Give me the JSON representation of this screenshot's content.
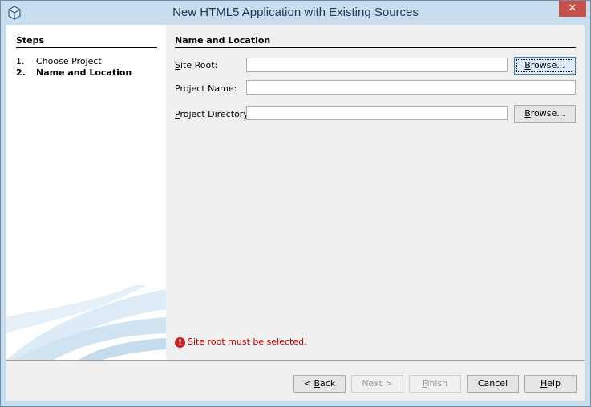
{
  "window": {
    "title": "New HTML5 Application with Existing Sources",
    "close_glyph": "✕"
  },
  "steps": {
    "header": "Steps",
    "items": [
      {
        "num": "1.",
        "label": "Choose Project"
      },
      {
        "num": "2.",
        "label": "Name and Location"
      }
    ]
  },
  "form": {
    "section_title": "Name and Location",
    "site_root": {
      "label_mnemonic": "S",
      "label_rest": "ite Root:",
      "value": "",
      "browse_mnemonic": "B",
      "browse_rest": "rowse..."
    },
    "project_name": {
      "label": "Project Name:",
      "value": ""
    },
    "project_directory": {
      "label_mnemonic": "P",
      "label_rest": "roject Directory:",
      "value": "",
      "browse_mnemonic": "B",
      "browse_rest": "rowse..."
    },
    "error_glyph": "!",
    "error_message": "Site root must be selected."
  },
  "buttons": {
    "back_prefix": "< ",
    "back_mnemonic": "B",
    "back_rest": "ack",
    "next": "Next >",
    "finish_mnemonic": "F",
    "finish_rest": "inish",
    "cancel": "Cancel",
    "help_mnemonic": "H",
    "help_rest": "elp"
  }
}
